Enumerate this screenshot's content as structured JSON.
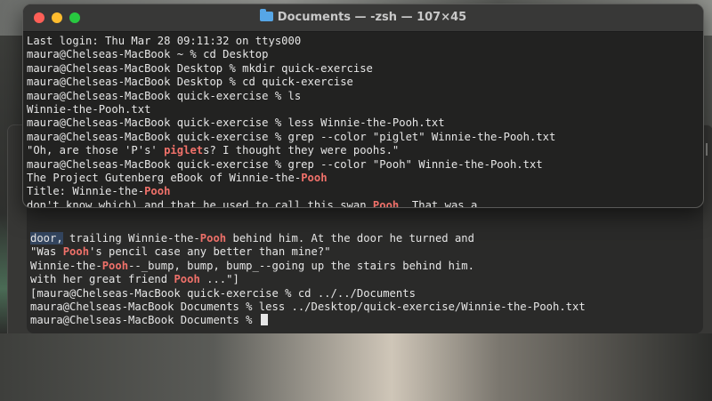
{
  "window": {
    "title": "Documents — -zsh — 107×45",
    "controls": [
      "close",
      "minimize",
      "zoom"
    ]
  },
  "front_terminal": {
    "lines": [
      [
        {
          "t": "Last login: Thu Mar 28 09:11:32 on ttys000"
        }
      ],
      [
        {
          "t": "maura@Chelseas-MacBook ~ % cd Desktop"
        }
      ],
      [
        {
          "t": "maura@Chelseas-MacBook Desktop % mkdir quick-exercise"
        }
      ],
      [
        {
          "t": "maura@Chelseas-MacBook Desktop % cd quick-exercise"
        }
      ],
      [
        {
          "t": "maura@Chelseas-MacBook quick-exercise % ls"
        }
      ],
      [
        {
          "t": "Winnie-the-Pooh.txt"
        }
      ],
      [
        {
          "t": "maura@Chelseas-MacBook quick-exercise % less Winnie-the-Pooh.txt"
        }
      ],
      [
        {
          "t": "maura@Chelseas-MacBook quick-exercise % grep --color \"piglet\" Winnie-the-Pooh.txt"
        }
      ],
      [
        {
          "t": "\"Oh, are those 'P's' "
        },
        {
          "t": "piglet",
          "hl": true
        },
        {
          "t": "s? I thought they were poohs.\""
        }
      ],
      [
        {
          "t": "maura@Chelseas-MacBook quick-exercise % grep --color \"Pooh\" Winnie-the-Pooh.txt"
        }
      ],
      [
        {
          "t": "The Project Gutenberg eBook of Winnie-the-"
        },
        {
          "t": "Pooh",
          "hl": true
        }
      ],
      [
        {
          "t": "Title: Winnie-the-"
        },
        {
          "t": "Pooh",
          "hl": true
        }
      ],
      [
        {
          "t": "don't know which) and that he used to call this swan "
        },
        {
          "t": "Pooh",
          "hl": true
        },
        {
          "t": ". That was a"
        }
      ]
    ]
  },
  "back_terminal": {
    "lines": [
      [
        {
          "t": "door,",
          "sel": true
        },
        {
          "t": " trailing Winnie-the-"
        },
        {
          "t": "Pooh",
          "hl": true
        },
        {
          "t": " behind him. At the door he turned and"
        }
      ],
      [
        {
          "t": "\"Was "
        },
        {
          "t": "Pooh",
          "hl": true
        },
        {
          "t": "'s pencil case any better than mine?\""
        }
      ],
      [
        {
          "t": "Winnie-the-"
        },
        {
          "t": "Pooh",
          "hl": true
        },
        {
          "t": "--_bump, bump, bump_--going up the stairs behind him."
        }
      ],
      [
        {
          "t": "with her great friend "
        },
        {
          "t": "Pooh",
          "hl": true
        },
        {
          "t": " ...\"]"
        }
      ],
      [
        {
          "t": "[maura@Chelseas-MacBook quick-exercise % cd ../../Documents"
        }
      ],
      [
        {
          "t": "maura@Chelseas-MacBook Documents % less ../Desktop/quick-exercise/Winnie-the-Pooh.txt"
        }
      ],
      [
        {
          "t": "maura@Chelseas-MacBook Documents % "
        }
      ]
    ]
  },
  "colors": {
    "match_highlight": "#f0716a",
    "selection": "#33455f",
    "terminal_bg": "#222221",
    "text": "#e6e6e6"
  }
}
